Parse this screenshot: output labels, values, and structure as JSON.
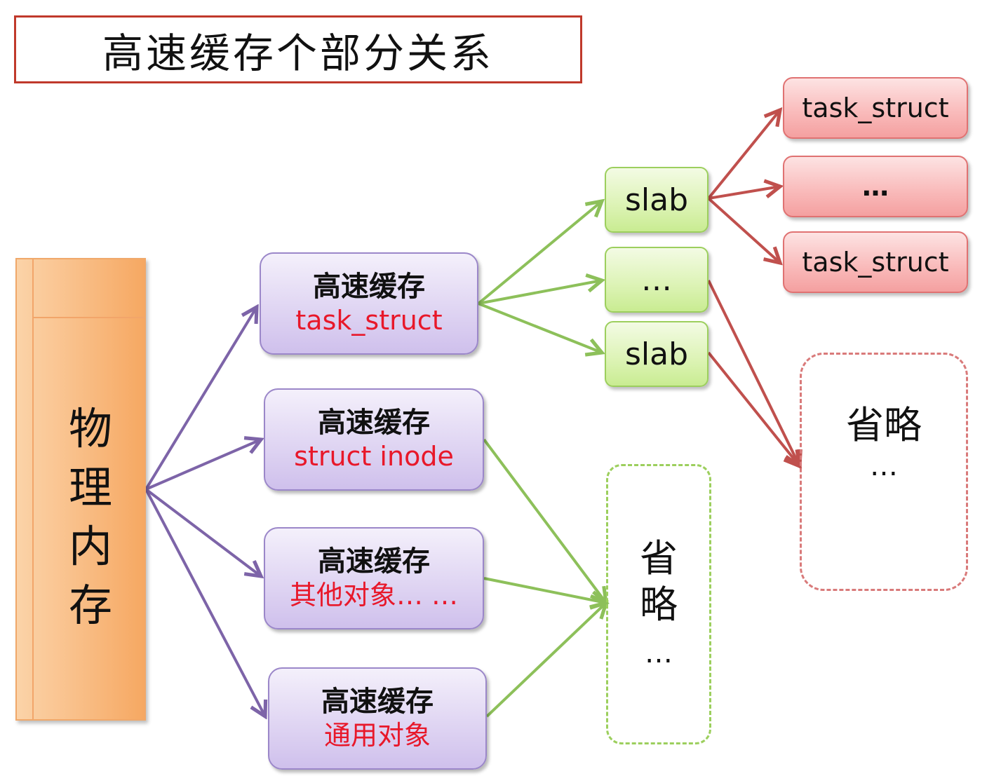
{
  "title": "高速缓存个部分关系",
  "memory": {
    "label": "物理内存"
  },
  "caches": [
    {
      "line1": "高速缓存",
      "line2": "task_struct"
    },
    {
      "line1": "高速缓存",
      "line2": "struct inode"
    },
    {
      "line1": "高速缓存",
      "line2": "其他对象… …"
    },
    {
      "line1": "高速缓存",
      "line2": "通用对象"
    }
  ],
  "slabs": [
    "slab",
    "…",
    "slab"
  ],
  "objects": [
    "task_struct",
    "…",
    "task_struct"
  ],
  "omitted_green": {
    "label": "省略",
    "dots": "…"
  },
  "omitted_red": {
    "label": "省略",
    "dots": "…"
  },
  "colors": {
    "purple_arrow": "#7d64a8",
    "green_arrow": "#8dc05a",
    "red_arrow": "#c0504d",
    "cache_text_red": "#e8182a"
  }
}
